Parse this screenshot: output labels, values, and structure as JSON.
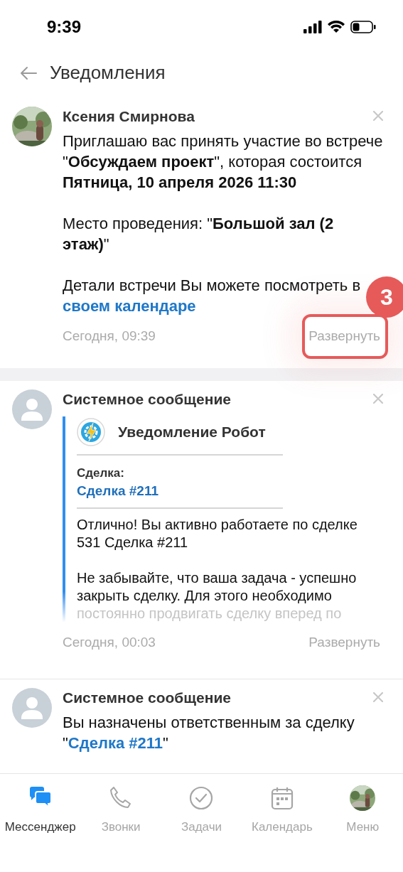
{
  "status_bar": {
    "time": "9:39"
  },
  "header": {
    "title": "Уведомления"
  },
  "notifications": [
    {
      "kind": "invite",
      "sender": "Ксения Смирнова",
      "paragraphs": [
        "Приглашаю вас принять участие во встрече \"**Обсуждаем проект**\", которая состоится **Пятница, 10 апреля 2026 11:30**",
        "Место проведения: \"**Большой зал (2 этаж)**\"",
        "Детали встречи Вы можете посмотреть в"
      ],
      "link": "своем календаре",
      "timestamp": "Сегодня, 09:39",
      "expand_label": "Развернуть",
      "callout": "3"
    },
    {
      "kind": "robot",
      "avatar": {
        "kind": "placeholder"
      },
      "sender": "Системное сообщение",
      "bot_name": "Уведомление Робот",
      "field_label": "Сделка:",
      "field_link": "Сделка #211",
      "paragraphs": [
        "Отлично! Вы активно работаете по сделке 531 Сделка #211",
        "Не забывайте, что ваша задача - успешно закрыть сделку. Для этого необходимо"
      ],
      "faded_line": "постоянно продвигать сделку вперед по",
      "timestamp": "Сегодня, 00:03",
      "expand_label": "Развернуть"
    },
    {
      "kind": "plain",
      "avatar": {
        "kind": "placeholder"
      },
      "sender": "Системное сообщение",
      "text": "Вы назначены ответственным за сделку \"",
      "link": "Сделка #211",
      "text_after": "\""
    }
  ],
  "tabs": [
    {
      "kind": "messenger",
      "label": "Мессенджер",
      "selected": true
    },
    {
      "kind": "calls",
      "label": "Звонки",
      "selected": false
    },
    {
      "kind": "tasks",
      "label": "Задачи",
      "selected": false
    },
    {
      "kind": "calendar",
      "label": "Календарь",
      "selected": false
    },
    {
      "kind": "menu",
      "label": "Меню",
      "selected": false
    }
  ]
}
